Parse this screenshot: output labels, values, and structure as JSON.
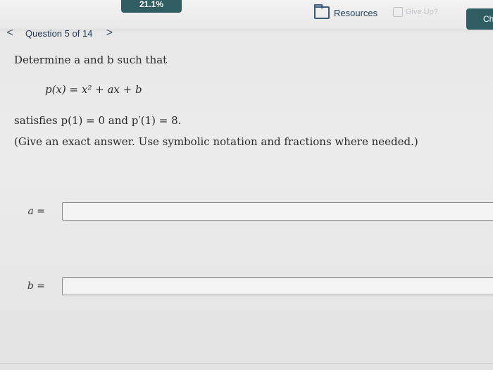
{
  "top": {
    "progress": "21.1%",
    "resources_label": "Resources",
    "giveup_label": "Give Up?",
    "check_label": "Ch"
  },
  "nav": {
    "prev_label": "<",
    "title": "Question 5 of 14",
    "next_label": ">"
  },
  "problem": {
    "prompt": "Determine a and b such that",
    "equation": "p(x) = x² + ax + b",
    "condition": "satisfies p(1) = 0 and p′(1) = 8.",
    "instruction": "(Give an exact answer. Use symbolic notation and fractions where needed.)"
  },
  "answers": [
    {
      "label": "a =",
      "value": ""
    },
    {
      "label": "b =",
      "value": ""
    }
  ]
}
